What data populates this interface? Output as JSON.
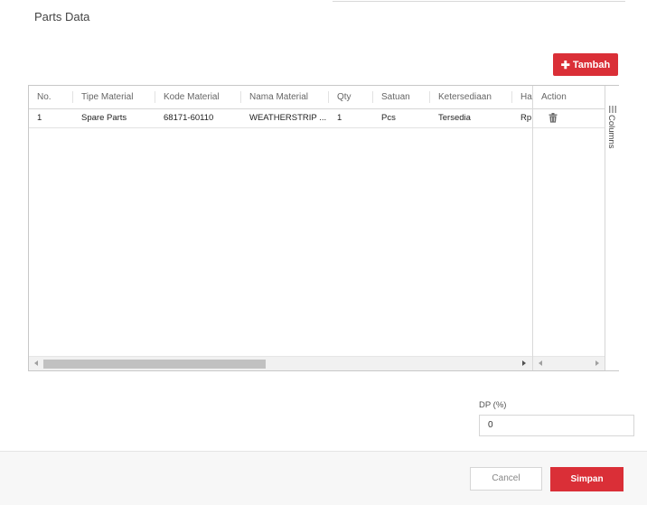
{
  "page": {
    "title": "Parts Data"
  },
  "toolbar": {
    "add_label": "Tambah"
  },
  "table": {
    "columns": [
      "No.",
      "Tipe Material",
      "Kode Material",
      "Nama Material",
      "Qty",
      "Satuan",
      "Ketersediaan",
      "Ha",
      "Action"
    ],
    "rows": [
      [
        "1",
        "Spare Parts",
        "68171-60110",
        "WEATHERSTRIP ...",
        "1",
        "Pcs",
        "Tersedia",
        "Rp."
      ]
    ]
  },
  "side_panel": {
    "label": "Columns"
  },
  "icons": {
    "add": "plus-icon",
    "delete": "trash-icon",
    "columns": "columns-icon"
  },
  "form": {
    "dp_label": "DP (%)",
    "dp_value": "0"
  },
  "footer": {
    "cancel_label": "Cancel",
    "save_label": "Simpan"
  },
  "colors": {
    "primary": "#da2f37"
  }
}
